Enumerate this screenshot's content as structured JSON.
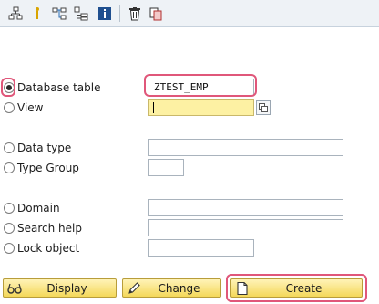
{
  "toolbar": {
    "icons": [
      "hierarchy-icon",
      "info-pin-icon",
      "where-used-icon",
      "object-list-icon",
      "information-icon",
      "delete-icon",
      "copy-icon"
    ]
  },
  "form": {
    "db_table": {
      "label": "Database table",
      "value": "ZTEST_EMP",
      "selected": true
    },
    "view": {
      "label": "View",
      "value": ""
    },
    "data_type": {
      "label": "Data type",
      "value": ""
    },
    "type_group": {
      "label": "Type Group",
      "value": ""
    },
    "domain": {
      "label": "Domain",
      "value": ""
    },
    "search_help": {
      "label": "Search help",
      "value": ""
    },
    "lock_object": {
      "label": "Lock object",
      "value": ""
    }
  },
  "buttons": {
    "display": "Display",
    "change": "Change",
    "create": "Create"
  },
  "colors": {
    "highlight": "#e0577a",
    "focus_field": "#fdf1a3",
    "button_top": "#fff3b8",
    "button_bottom": "#f4d85a"
  }
}
